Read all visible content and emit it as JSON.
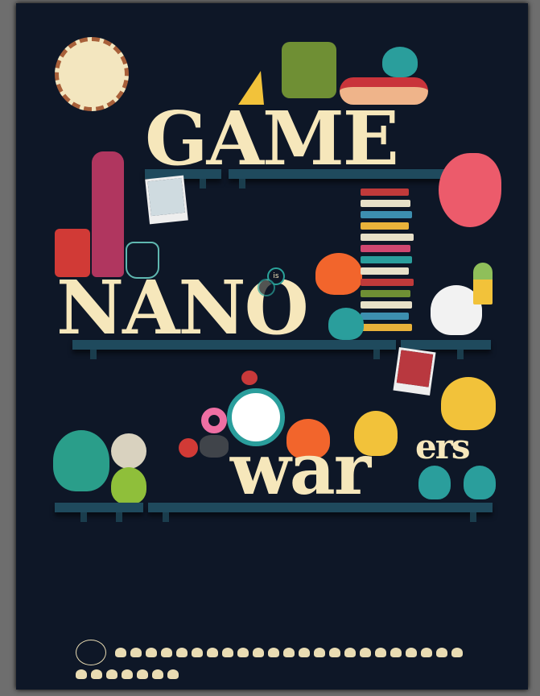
{
  "poster": {
    "title_line1": "GAME",
    "title_line2": "NANO",
    "small_word": "is",
    "title_line3a": "war",
    "title_line3b": "ers",
    "icon_strip_count": 30
  },
  "colors": {
    "background": "#0e1727",
    "lettering": "#f6e7bb",
    "shelf": "#1f4a5d",
    "frame": "#6e6e6e"
  }
}
